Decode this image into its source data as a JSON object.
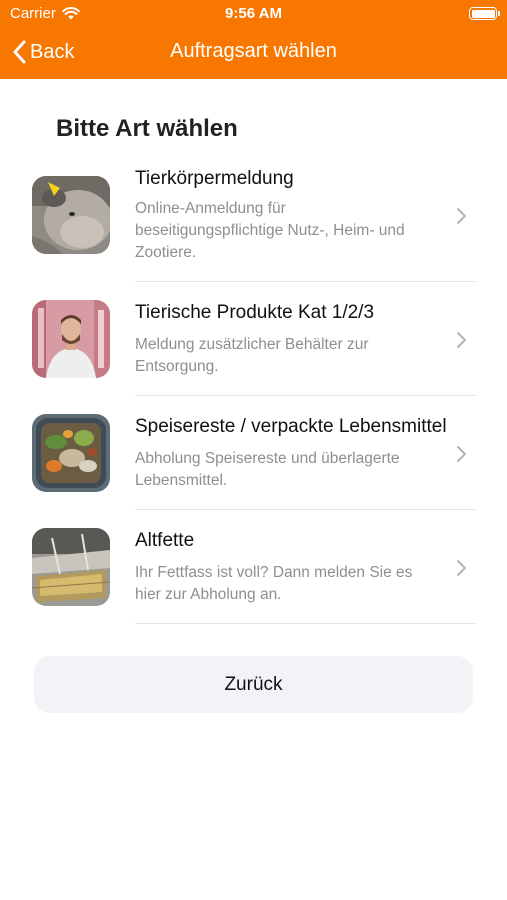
{
  "status_bar": {
    "carrier": "Carrier",
    "time": "9:56 AM"
  },
  "nav": {
    "back_label": "Back",
    "title": "Auftragsart wählen"
  },
  "page": {
    "heading": "Bitte Art wählen"
  },
  "items": [
    {
      "title": "Tierkörpermeldung",
      "subtitle": "Online-Anmeldung für beseitigungspflichtige Nutz-, Heim- und Zootiere.",
      "icon": "cow-photo"
    },
    {
      "title": "Tierische Produkte Kat 1/2/3",
      "subtitle": "Meldung zusätzlicher Behälter zur Entsorgung.",
      "icon": "butcher-photo"
    },
    {
      "title": "Speisereste / verpackte Lebensmittel",
      "subtitle": "Abholung Speisereste und überlagerte Lebensmittel.",
      "icon": "food-waste-photo"
    },
    {
      "title": "Altfette",
      "subtitle": "Ihr Fettfass ist voll? Dann melden Sie es hier zur Abholung an.",
      "icon": "fryer-fat-photo"
    }
  ],
  "footer": {
    "button_label": "Zurück"
  },
  "colors": {
    "accent": "#f87700",
    "button_bg": "#f2f2f7",
    "subtitle": "#8e8e93"
  }
}
